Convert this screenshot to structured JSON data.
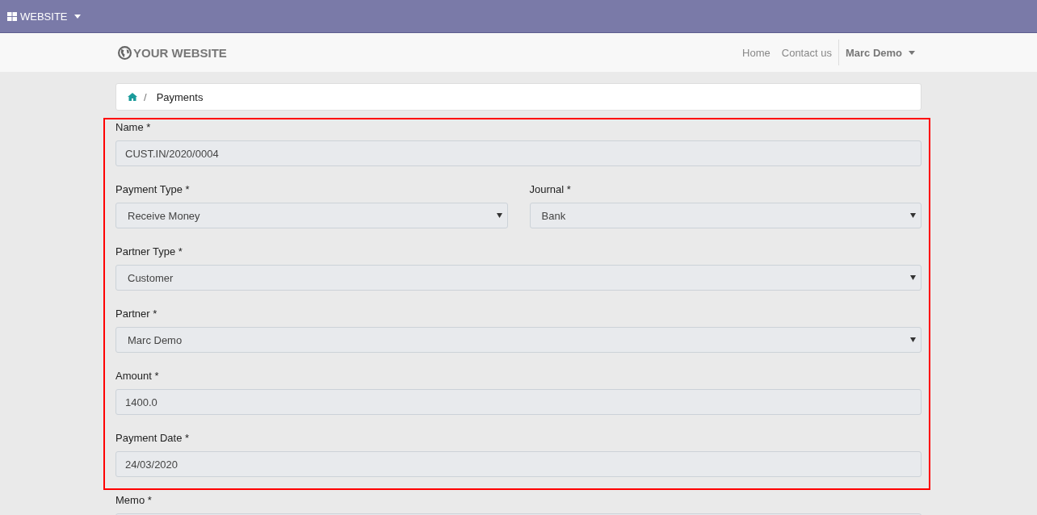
{
  "top_bar": {
    "app_menu": "WEBSITE"
  },
  "navbar": {
    "logo": "YOUR WEBSITE",
    "links": [
      {
        "label": "Home"
      },
      {
        "label": "Contact us"
      }
    ],
    "user": "Marc Demo"
  },
  "breadcrumb": {
    "separator": "/",
    "current": "Payments"
  },
  "form": {
    "highlighted_rows": [
      {
        "fields": [
          {
            "label": "Name *",
            "kind": "text",
            "value": "CUST.IN/2020/0004"
          }
        ]
      },
      {
        "fields": [
          {
            "label": "Payment Type *",
            "kind": "select",
            "value": "Receive Money"
          },
          {
            "label": "Journal *",
            "kind": "select",
            "value": "Bank"
          }
        ]
      },
      {
        "fields": [
          {
            "label": "Partner Type *",
            "kind": "select",
            "value": "Customer"
          }
        ]
      },
      {
        "fields": [
          {
            "label": "Partner *",
            "kind": "select",
            "value": "Marc Demo"
          }
        ]
      },
      {
        "fields": [
          {
            "label": "Amount *",
            "kind": "text",
            "value": "1400.0"
          }
        ]
      },
      {
        "fields": [
          {
            "label": "Payment Date *",
            "kind": "text",
            "value": "24/03/2020"
          }
        ]
      }
    ],
    "rows": [
      {
        "fields": [
          {
            "label": "Memo *",
            "kind": "text"
          }
        ]
      }
    ]
  }
}
